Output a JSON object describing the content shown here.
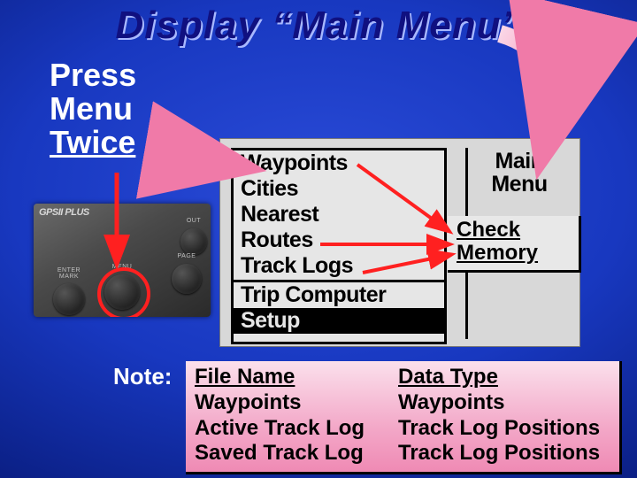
{
  "title": "Display “Main Menu”",
  "pressBlock": {
    "line1": "Press",
    "line2": "Menu",
    "line3": "Twice"
  },
  "device": {
    "logo": "GPSII PLUS",
    "buttons": {
      "out": "OUT",
      "page": "PAGE",
      "menu": "MENU",
      "enter": "ENTER\nMARK"
    }
  },
  "gps": {
    "items": [
      "Waypoints",
      "Cities",
      "Nearest",
      "Routes",
      "Track Logs"
    ],
    "belowSep": "Trip Computer",
    "selected": "Setup",
    "rightTitle1": "Main",
    "rightTitle2": "Menu"
  },
  "checkMemory": {
    "line1": "Check",
    "line2": "Memory"
  },
  "noteLabel": "Note:",
  "noteTable": {
    "header1": "File Name",
    "header2": "Data Type",
    "rows": [
      {
        "c1": "Waypoints",
        "c2": "Waypoints"
      },
      {
        "c1": "Active Track Log",
        "c2": "Track Log Positions"
      },
      {
        "c1": "Saved Track Log",
        "c2": "Track Log Positions"
      }
    ]
  }
}
